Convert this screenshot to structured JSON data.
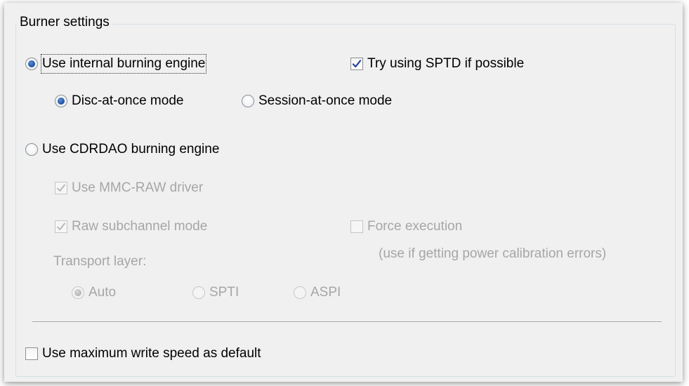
{
  "group": {
    "title": "Burner settings"
  },
  "internal_engine": {
    "label": "Use internal burning engine",
    "selected": true,
    "sptd": {
      "label": "Try using SPTD if possible",
      "checked": true
    },
    "modes": [
      {
        "label": "Disc-at-once mode",
        "selected": true
      },
      {
        "label": "Session-at-once mode",
        "selected": false
      }
    ]
  },
  "cdrdao_engine": {
    "label": "Use CDRDAO burning engine",
    "selected": false,
    "mmc_raw": {
      "label": "Use MMC-RAW driver",
      "checked": true,
      "enabled": false
    },
    "raw_subchannel": {
      "label": "Raw subchannel mode",
      "checked": true,
      "enabled": false
    },
    "force_execution": {
      "label": "Force execution",
      "checked": false,
      "enabled": false
    },
    "force_note": "(use if getting power calibration errors)",
    "transport_label": "Transport layer:",
    "transport_options": [
      {
        "label": "Auto",
        "selected": true
      },
      {
        "label": "SPTI",
        "selected": false
      },
      {
        "label": "ASPI",
        "selected": false
      }
    ]
  },
  "max_speed": {
    "label": "Use maximum write speed as default",
    "checked": false
  },
  "colors": {
    "panel_bg": "#f0f0f0",
    "disabled_text": "#a6a6a6",
    "radio_dot": "#1c4e9c",
    "check_mark": "#21439c"
  }
}
